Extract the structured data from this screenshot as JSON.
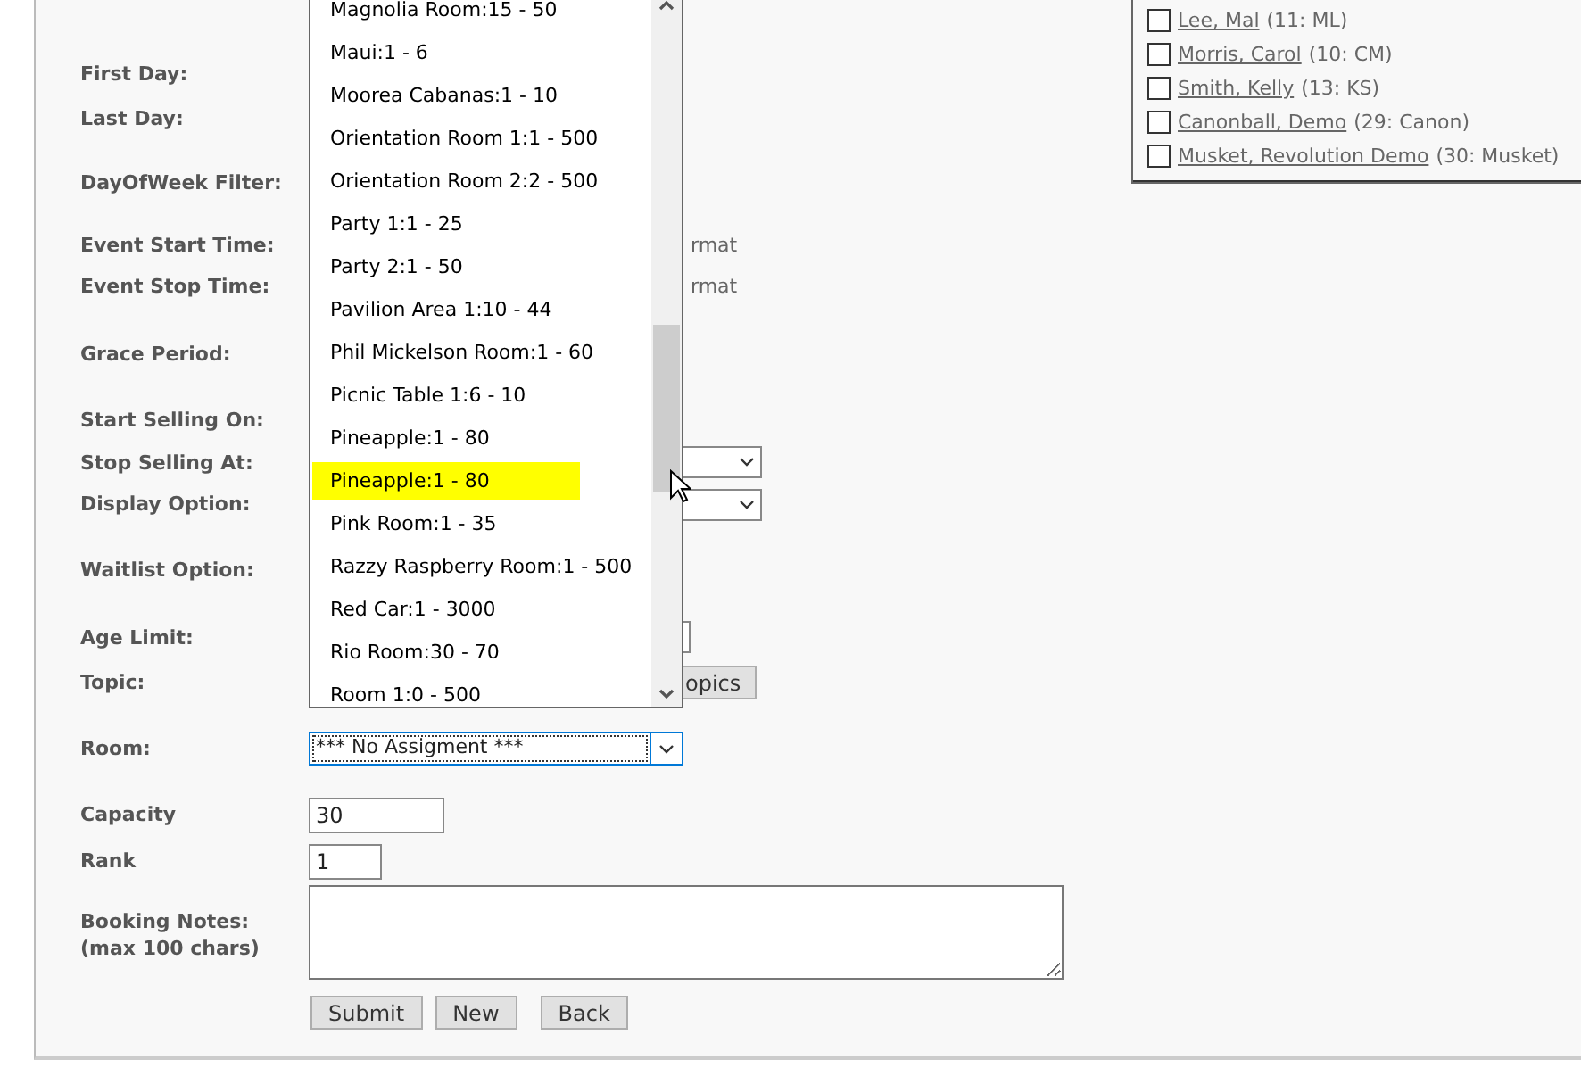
{
  "form": {
    "rows": [
      {
        "label": "First Day:",
        "kind": "empty"
      },
      {
        "label": "Last Day:",
        "kind": "empty"
      },
      {
        "label": "DayOfWeek Filter:",
        "kind": "empty"
      },
      {
        "label": "Event Start Time:",
        "kind": "hint",
        "hint": "rmat"
      },
      {
        "label": "Event Stop Time:",
        "kind": "hint",
        "hint": "rmat"
      },
      {
        "label": "Grace Period:",
        "kind": "empty"
      },
      {
        "label": "Start Selling On:",
        "kind": "empty"
      },
      {
        "label": "Stop Selling At:",
        "kind": "select"
      },
      {
        "label": "Display Option:",
        "kind": "select"
      },
      {
        "label": "Waitlist Option:",
        "kind": "empty"
      },
      {
        "label": "Age Limit:",
        "kind": "input"
      },
      {
        "label": "Topic:",
        "kind": "button",
        "button": "opics"
      },
      {
        "label": "Room:",
        "kind": "room",
        "value": "*** No Assigment ***"
      },
      {
        "label": "Capacity",
        "kind": "text",
        "value": "30"
      },
      {
        "label": "Rank",
        "kind": "text",
        "value": "1"
      },
      {
        "label": "Booking Notes:\n(max 100 chars)",
        "kind": "textarea"
      }
    ],
    "buttons": [
      "Submit",
      "New",
      "Back"
    ]
  },
  "room_dropdown": {
    "options": [
      {
        "label": "Magnolia Room:15 - 50",
        "selected": false
      },
      {
        "label": "Maui:1 - 6",
        "selected": false
      },
      {
        "label": "Moorea Cabanas:1 - 10",
        "selected": false
      },
      {
        "label": "Orientation Room 1:1 - 500",
        "selected": false
      },
      {
        "label": "Orientation Room 2:2 - 500",
        "selected": false
      },
      {
        "label": "Party 1:1 - 25",
        "selected": false
      },
      {
        "label": "Party 2:1 - 50",
        "selected": false
      },
      {
        "label": "Pavilion Area 1:10 - 44",
        "selected": false
      },
      {
        "label": "Phil Mickelson Room:1 - 60",
        "selected": false
      },
      {
        "label": "Picnic Table 1:6 - 10",
        "selected": false
      },
      {
        "label": "Pineapple:1 - 80",
        "selected": false
      },
      {
        "label": "Pineapple:1 - 80",
        "selected": true
      },
      {
        "label": "Pink Room:1 - 35",
        "selected": false
      },
      {
        "label": "Razzy Raspberry Room:1 - 500",
        "selected": false
      },
      {
        "label": "Red Car:1 - 3000",
        "selected": false
      },
      {
        "label": "Rio Room:30 - 70",
        "selected": false
      },
      {
        "label": "Room 1:0 - 500",
        "selected": false
      }
    ]
  },
  "staff": [
    {
      "name": "Lee, Mal",
      "code": "(11: ML)",
      "checked": false
    },
    {
      "name": "Morris, Carol",
      "code": "(10: CM)",
      "checked": false
    },
    {
      "name": "Smith, Kelly",
      "code": "(13: KS)",
      "checked": false
    },
    {
      "name": "Canonball, Demo",
      "code": "(29: Canon)",
      "checked": false
    },
    {
      "name": "Musket, Revolution Demo",
      "code": "(30: Musket)",
      "checked": false
    }
  ]
}
